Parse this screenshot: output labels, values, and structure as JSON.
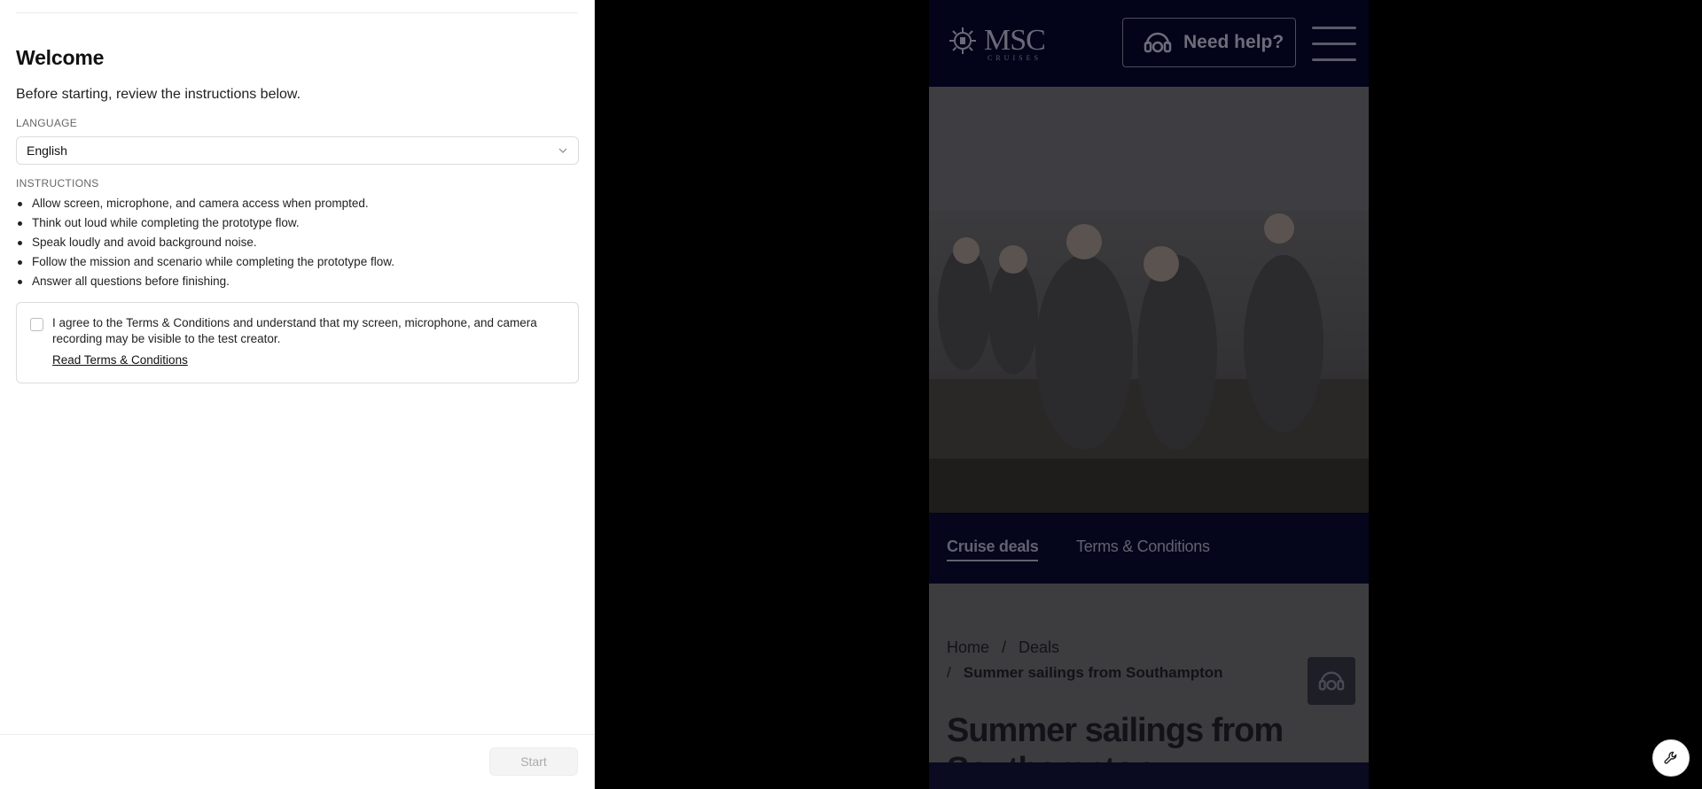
{
  "panel": {
    "title": "Welcome",
    "subtitle": "Before starting, review the instructions below.",
    "language": {
      "label": "LANGUAGE",
      "selected": "English"
    },
    "instructions": {
      "label": "INSTRUCTIONS",
      "items": [
        "Allow screen, microphone, and camera access when prompted.",
        "Think out loud while completing the prototype flow.",
        "Speak loudly and avoid background noise.",
        "Follow the mission and scenario while completing the prototype flow.",
        "Answer all questions before finishing."
      ]
    },
    "consent": {
      "text": "I agree to the Terms & Conditions and understand that my screen, microphone, and camera recording may be visible to the test creator.",
      "link": "Read Terms & Conditions",
      "checked": false
    },
    "start_label": "Start"
  },
  "prototype": {
    "logo_text": "MSC",
    "logo_sub": "CRUISES",
    "help_label": "Need help?",
    "tabs": [
      "Cruise deals",
      "Terms & Conditions"
    ],
    "breadcrumb": {
      "home": "Home",
      "sep": "/",
      "deals": "Deals",
      "current": "Summer sailings from Southampton"
    },
    "heading": "Summer sailings from Southampton"
  },
  "icons": {
    "chevron": "chevron-down-icon",
    "headset": "headset-icon",
    "menu": "hamburger-menu-icon",
    "tool": "wrench-icon"
  }
}
